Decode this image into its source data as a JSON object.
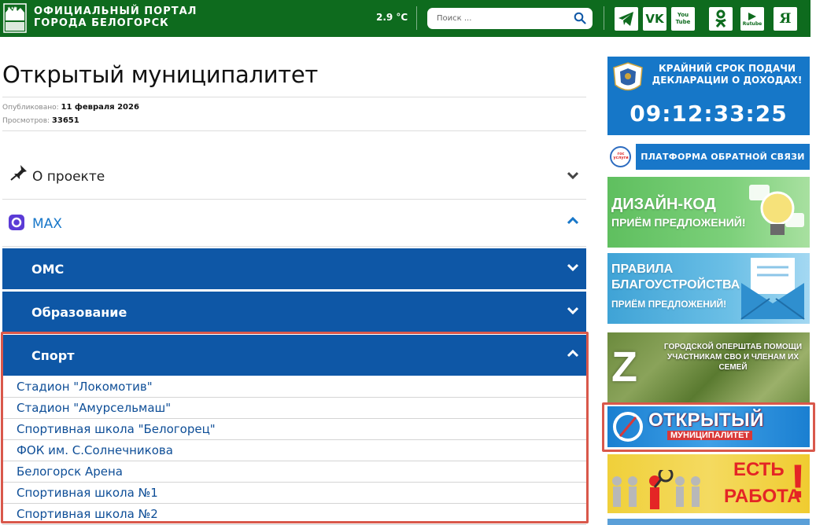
{
  "header": {
    "logo_line1": "ОФИЦИАЛЬНЫЙ ПОРТАЛ",
    "logo_line2": "ГОРОДА БЕЛОГОРСК",
    "temperature": "2.9 °C",
    "search_placeholder": "Поиск ...",
    "social": [
      {
        "name": "telegram-icon",
        "label": ""
      },
      {
        "name": "vk-icon",
        "label": "VK"
      },
      {
        "name": "youtube-icon",
        "label": "You Tube"
      },
      {
        "name": "odnoklassniki-icon",
        "label": ""
      },
      {
        "name": "rutube-icon",
        "label": "Rutube"
      },
      {
        "name": "yandex-icon",
        "label": "Я"
      }
    ]
  },
  "page": {
    "title": "Открытый муниципалитет",
    "published_label": "Опубликовано:",
    "published_date": "11 февраля 2026",
    "views_label": "Просмотров:",
    "views_count": "33651"
  },
  "accordion": {
    "about": "О проекте",
    "max": "MAX",
    "oms": "ОМС",
    "education": "Образование",
    "sport": "Спорт"
  },
  "sport_items": [
    "Стадион \"Локомотив\"",
    "Стадион \"Амурсельмаш\"",
    "Спортивная школа \"Белогорец\"",
    "ФОК им. С.Солнечникова",
    "Белогорск Арена",
    "Спортивная школа №1",
    "Спортивная школа №2"
  ],
  "banners": {
    "deadline_text": "КРАЙНИЙ СРОК ПОДАЧИ ДЕКЛАРАЦИИ О ДОХОДАХ!",
    "deadline_clock": "09:12:33:25",
    "feedback": "ПЛАТФОРМА ОБРАТНОЙ СВЯЗИ",
    "gosuslugi": "гос услуги",
    "design_line1": "ДИЗАЙН-КОД",
    "design_line2": "ПРИЁМ ПРЕДЛОЖЕНИЙ!",
    "rules_line1": "ПРАВИЛА",
    "rules_line2": "БЛАГОУСТРОЙСТВА",
    "rules_line3": "ПРИЁМ ПРЕДЛОЖЕНИЙ!",
    "svo_text": "ГОРОДСКОЙ ОПЕРШТАБ ПОМОЩИ УЧАСТНИКАМ СВО И ЧЛЕНАМ ИХ СЕМЕЙ",
    "svo_letter": "Z",
    "open_line1": "ОТКРЫТЫЙ",
    "open_line2": "МУНИЦИПАЛИТЕТ",
    "job_line1": "ЕСТЬ",
    "job_line2": "РАБОТА",
    "job_mark": "!"
  },
  "colors": {
    "header_green": "#0e6b1e",
    "accordion_blue": "#0e57a6",
    "link_blue": "#0e4e97",
    "highlight_red": "#d9584b"
  }
}
